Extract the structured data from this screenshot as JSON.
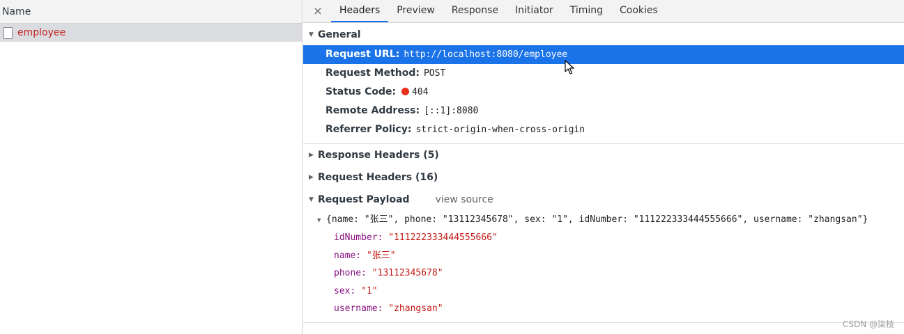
{
  "left": {
    "column_header": "Name",
    "requests": [
      {
        "name": "employee",
        "icon": "file-icon"
      }
    ]
  },
  "tabs": {
    "close_icon": "×",
    "items": [
      "Headers",
      "Preview",
      "Response",
      "Initiator",
      "Timing",
      "Cookies"
    ],
    "active": "Headers"
  },
  "general": {
    "title": "General",
    "request_url_label": "Request URL:",
    "request_url": "http://localhost:8080/employee",
    "request_method_label": "Request Method:",
    "request_method": "POST",
    "status_code_label": "Status Code:",
    "status_code": "404",
    "remote_address_label": "Remote Address:",
    "remote_address": "[::1]:8080",
    "referrer_policy_label": "Referrer Policy:",
    "referrer_policy": "strict-origin-when-cross-origin"
  },
  "response_headers": {
    "title": "Response Headers (5)"
  },
  "request_headers": {
    "title": "Request Headers (16)"
  },
  "payload": {
    "title": "Request Payload",
    "view_source": "view source",
    "summary": "{name: \"张三\", phone: \"13112345678\", sex: \"1\", idNumber: \"111222333444555666\", username: \"zhangsan\"}",
    "fields": [
      {
        "key": "idNumber:",
        "value": "\"111222333444555666\""
      },
      {
        "key": "name:",
        "value": "\"张三\""
      },
      {
        "key": "phone:",
        "value": "\"13112345678\""
      },
      {
        "key": "sex:",
        "value": "\"1\""
      },
      {
        "key": "username:",
        "value": "\"zhangsan\""
      }
    ]
  },
  "colors": {
    "accent": "#1a73e8",
    "status_error": "#e8301c",
    "key": "#881280",
    "string": "#c41a16"
  },
  "watermark": "CSDN @柒枝"
}
